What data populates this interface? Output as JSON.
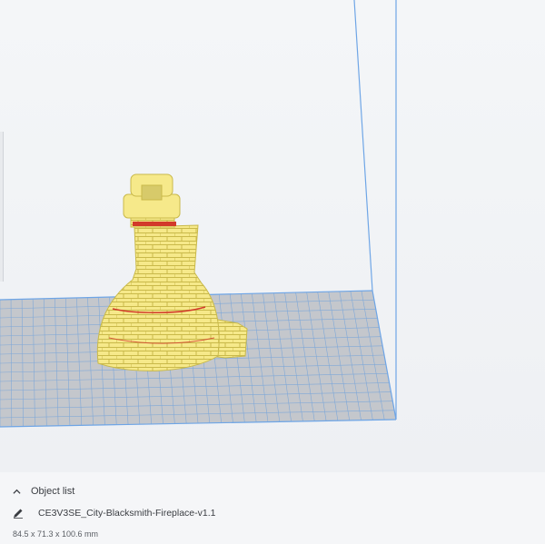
{
  "panel": {
    "object_list_label": "Object list",
    "object_list_icon": "chevron-up-icon",
    "object_name": "CE3V3SE_City-Blacksmith-Fireplace-v1.1",
    "object_icon": "pencil-icon",
    "dimensions": "84.5 x 71.3 x 100.6 mm"
  },
  "colors": {
    "build_plate": "#c4c7cc",
    "grid_line": "#7fa8d8",
    "volume_edge": "#6ea5e6",
    "model": "#f6e98a",
    "model_shadow": "#c9b94a",
    "overhang": "#d23a2a"
  }
}
